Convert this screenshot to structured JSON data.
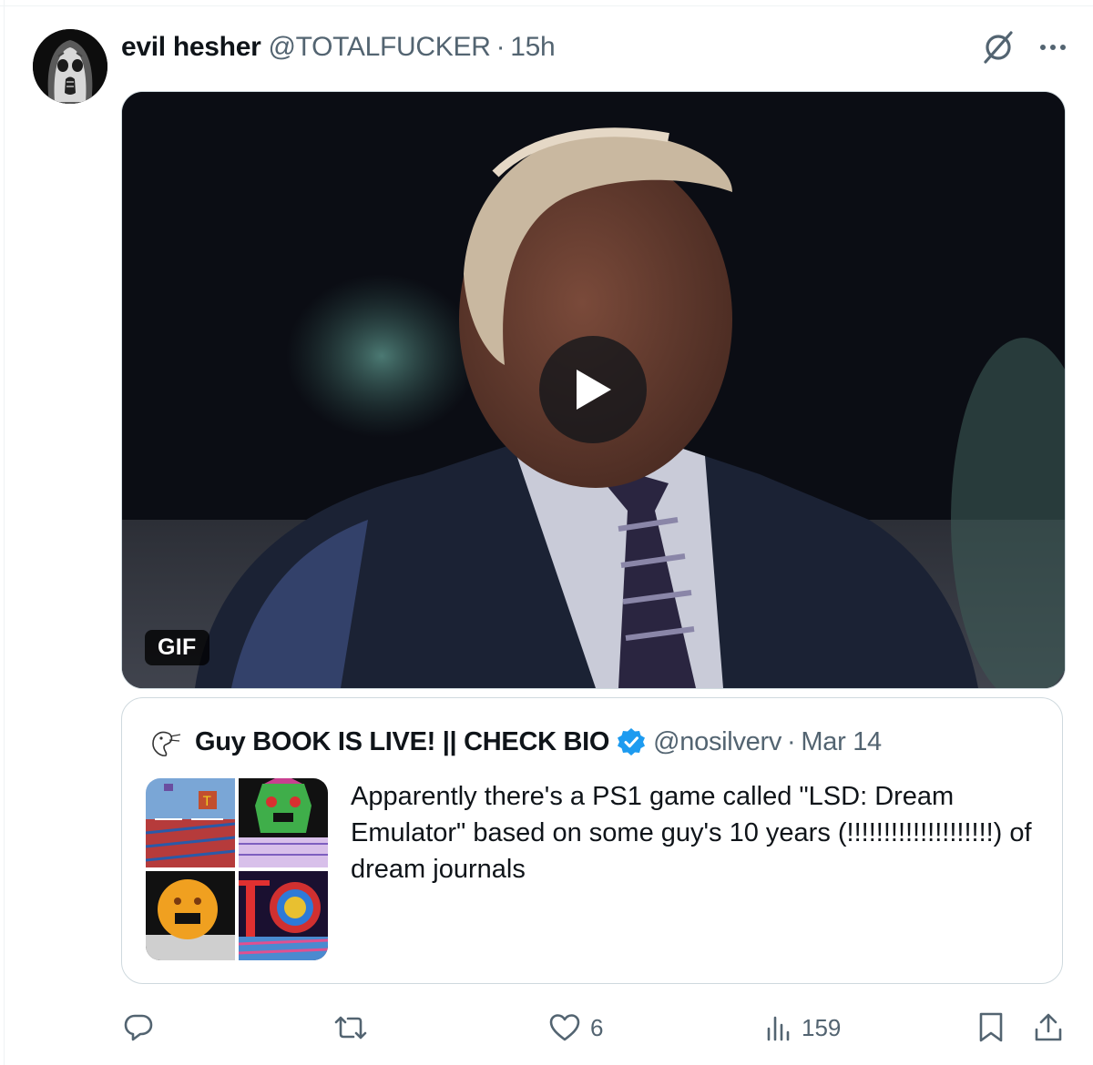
{
  "post": {
    "author_name": "evil hesher",
    "author_handle": "@TOTALFUCKER",
    "separator": "·",
    "time": "15h",
    "avatar_icon": "skull-face-avatar",
    "grok_icon": "grok-icon",
    "more_icon": "more-horizontal-icon",
    "media": {
      "type": "GIF",
      "badge": "GIF",
      "play_icon": "play-icon"
    }
  },
  "quoted_post": {
    "author_name": "Guy BOOK IS LIVE! || CHECK BIO",
    "verified": true,
    "verified_color": "#1d9bf0",
    "author_handle": "@nosilverv",
    "separator": "·",
    "date": "Mar 14",
    "text": "Apparently there's a PS1 game called \"LSD: Dream Emulator\" based on some guy's 10 years (!!!!!!!!!!!!!!!!!!!!) of dream journals",
    "thumbnail_count": 4
  },
  "actions": {
    "reply": {
      "icon": "reply-icon",
      "count": ""
    },
    "repost": {
      "icon": "repost-icon",
      "count": ""
    },
    "like": {
      "icon": "heart-icon",
      "count": "6"
    },
    "views": {
      "icon": "analytics-icon",
      "count": "159"
    },
    "bookmark": {
      "icon": "bookmark-icon"
    },
    "share": {
      "icon": "share-icon"
    }
  },
  "colors": {
    "text_primary": "#0f1419",
    "text_secondary": "#536471",
    "border": "#cfd9de",
    "accent": "#1d9bf0"
  }
}
